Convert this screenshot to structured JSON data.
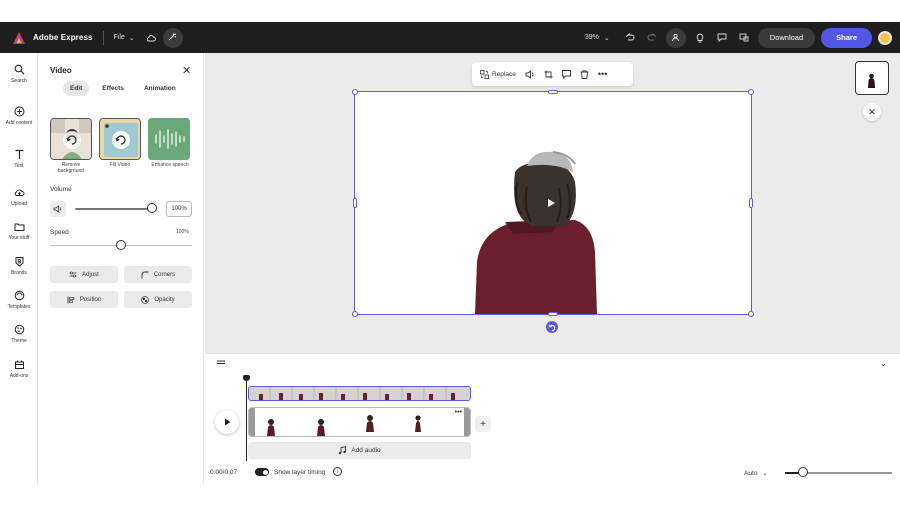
{
  "app": {
    "name": "Adobe Express",
    "file_menu": "File"
  },
  "topbar": {
    "zoom": "39%",
    "download_label": "Download",
    "share_label": "Share"
  },
  "rail": {
    "items": [
      {
        "label": "Search",
        "icon": "search-icon"
      },
      {
        "label": "Add content",
        "icon": "plus-circle-icon"
      },
      {
        "label": "Text",
        "icon": "text-icon"
      },
      {
        "label": "Upload",
        "icon": "upload-icon"
      },
      {
        "label": "Your stuff",
        "icon": "folder-icon"
      },
      {
        "label": "Brands",
        "icon": "brand-icon"
      },
      {
        "label": "Templates",
        "icon": "templates-icon"
      },
      {
        "label": "Theme",
        "icon": "palette-icon"
      },
      {
        "label": "Add-ons",
        "icon": "addons-icon"
      }
    ]
  },
  "panel": {
    "title": "Video",
    "tabs": [
      "Edit",
      "Effects",
      "Animation"
    ],
    "active_tab": "Edit",
    "cards": [
      {
        "label": "Remove background"
      },
      {
        "label": "Fill Video"
      },
      {
        "label": "Enhance speech"
      }
    ],
    "volume": {
      "label": "Volume",
      "value": "100%",
      "level": 1.0
    },
    "speed": {
      "label": "Speed",
      "value": "100%",
      "level": 0.5
    },
    "buttons": {
      "adjust": "Adjust",
      "corners": "Corners",
      "position": "Position",
      "opacity": "Opacity"
    }
  },
  "context_toolbar": {
    "replace_label": "Replace"
  },
  "timeline": {
    "time": "0:00/0:07",
    "add_audio": "Add audio",
    "show_layer_timing": "Show layer timing",
    "zoom_mode": "Auto"
  },
  "colors": {
    "accent": "#5258e4",
    "topbar": "#1e1e1e",
    "canvas_bg": "#ebebeb",
    "shirt": "#6b1f2c"
  }
}
